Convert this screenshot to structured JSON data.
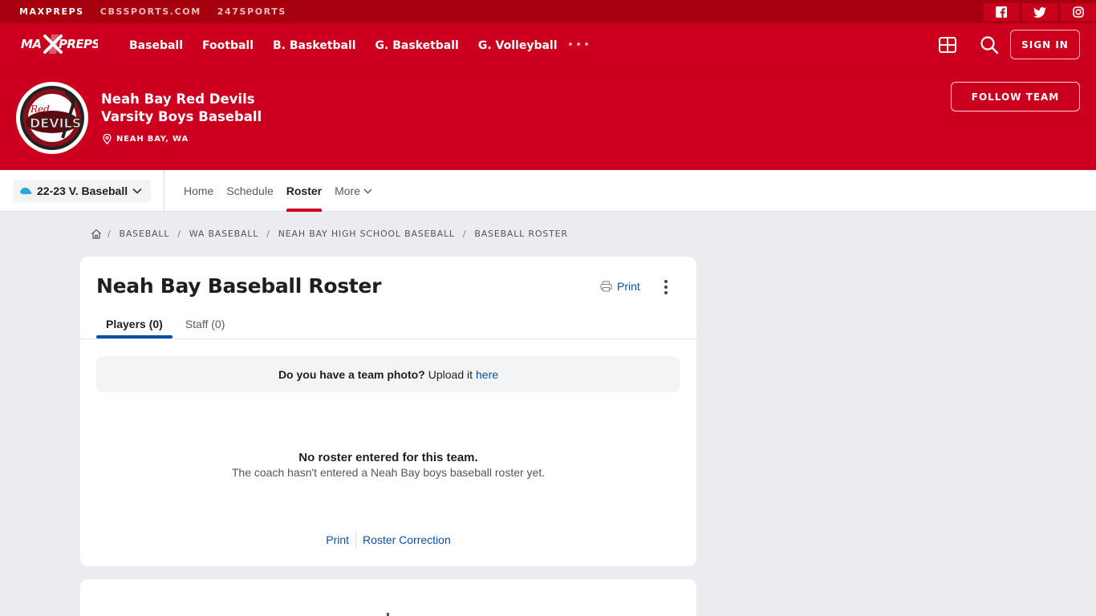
{
  "topstrip": {
    "links": [
      "MAXPREPS",
      "CBSSPORTS.COM",
      "247SPORTS"
    ],
    "social": [
      "facebook-icon",
      "twitter-icon",
      "instagram-icon"
    ]
  },
  "nav": {
    "logo_text": "MAXPREPS",
    "links": [
      "Baseball",
      "Football",
      "B. Basketball",
      "G. Basketball",
      "G. Volleyball"
    ],
    "signin": "SIGN IN"
  },
  "team": {
    "name_line1": "Neah Bay Red Devils",
    "name_line2": "Varsity Boys Baseball",
    "location": "NEAH BAY, WA",
    "follow": "FOLLOW TEAM",
    "logo_script": "Red",
    "logo_word": "DEVILS"
  },
  "subnav": {
    "season": "22-23 V. Baseball",
    "tabs": [
      "Home",
      "Schedule",
      "Roster",
      "More"
    ],
    "active_tab": "Roster"
  },
  "breadcrumb": [
    "BASEBALL",
    "WA BASEBALL",
    "NEAH BAY HIGH SCHOOL BASEBALL",
    "BASEBALL ROSTER"
  ],
  "roster": {
    "title": "Neah Bay Baseball Roster",
    "print": "Print",
    "tabs": [
      "Players (0)",
      "Staff (0)"
    ],
    "photo_question": "Do you have a team photo?",
    "photo_upload": "Upload it",
    "photo_link": "here",
    "empty_title": "No roster entered for this team.",
    "empty_sub": "The coach hasn't entered a Neah Bay boys baseball roster yet.",
    "bottom_print": "Print",
    "bottom_correction": "Roster Correction"
  },
  "colors": {
    "brand_red": "#cc001e",
    "dark_red": "#a6000f",
    "link_blue": "#0a4fa6",
    "page_bg": "#ececf0"
  }
}
